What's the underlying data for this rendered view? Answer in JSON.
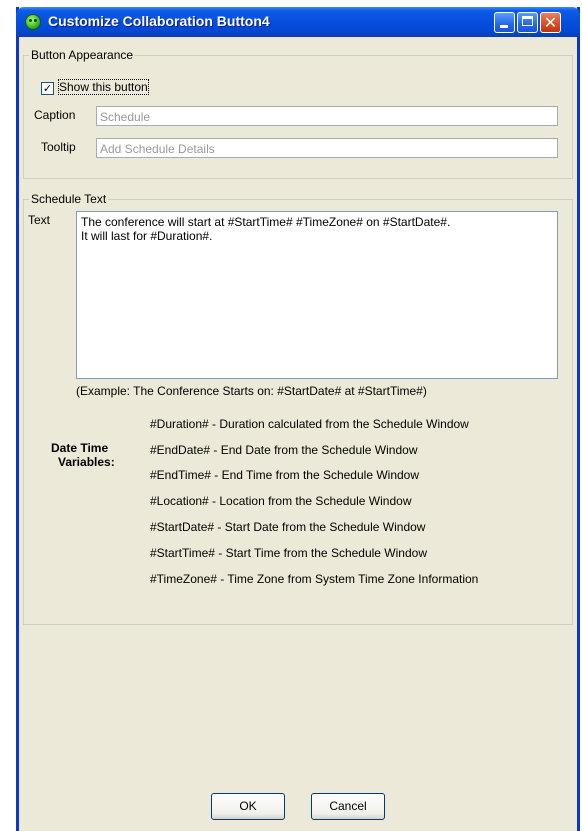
{
  "window": {
    "title": "Customize Collaboration Button4"
  },
  "appearance": {
    "legend": "Button Appearance",
    "show_label": "Show this button",
    "show_checked": "✓",
    "caption_label": "Caption",
    "caption_value": "Schedule",
    "tooltip_label": "Tooltip",
    "tooltip_value": "Add Schedule Details"
  },
  "schedule": {
    "legend": "Schedule Text",
    "text_label": "Text",
    "text_value": "The conference will start at #StartTime# #TimeZone# on #StartDate#.\nIt will last for #Duration#.",
    "example": "(Example: The Conference Starts on: #StartDate# at #StartTime#)",
    "variables_heading_line1": "Date Time",
    "variables_heading_line2": "Variables:",
    "variables": [
      "#Duration# - Duration calculated from the Schedule Window",
      "#EndDate# - End Date from the Schedule Window",
      "#EndTime# - End Time from the Schedule Window",
      "#Location# - Location from the Schedule Window",
      "#StartDate# - Start Date from the Schedule Window",
      "#StartTime# - Start Time from the Schedule Window",
      "#TimeZone# - Time Zone from System Time Zone Information"
    ]
  },
  "buttons": {
    "ok": "OK",
    "cancel": "Cancel"
  },
  "colors": {
    "titlebar": "#0550E0",
    "dialog_bg": "#ECE9D8",
    "close_button": "#D84B21"
  }
}
